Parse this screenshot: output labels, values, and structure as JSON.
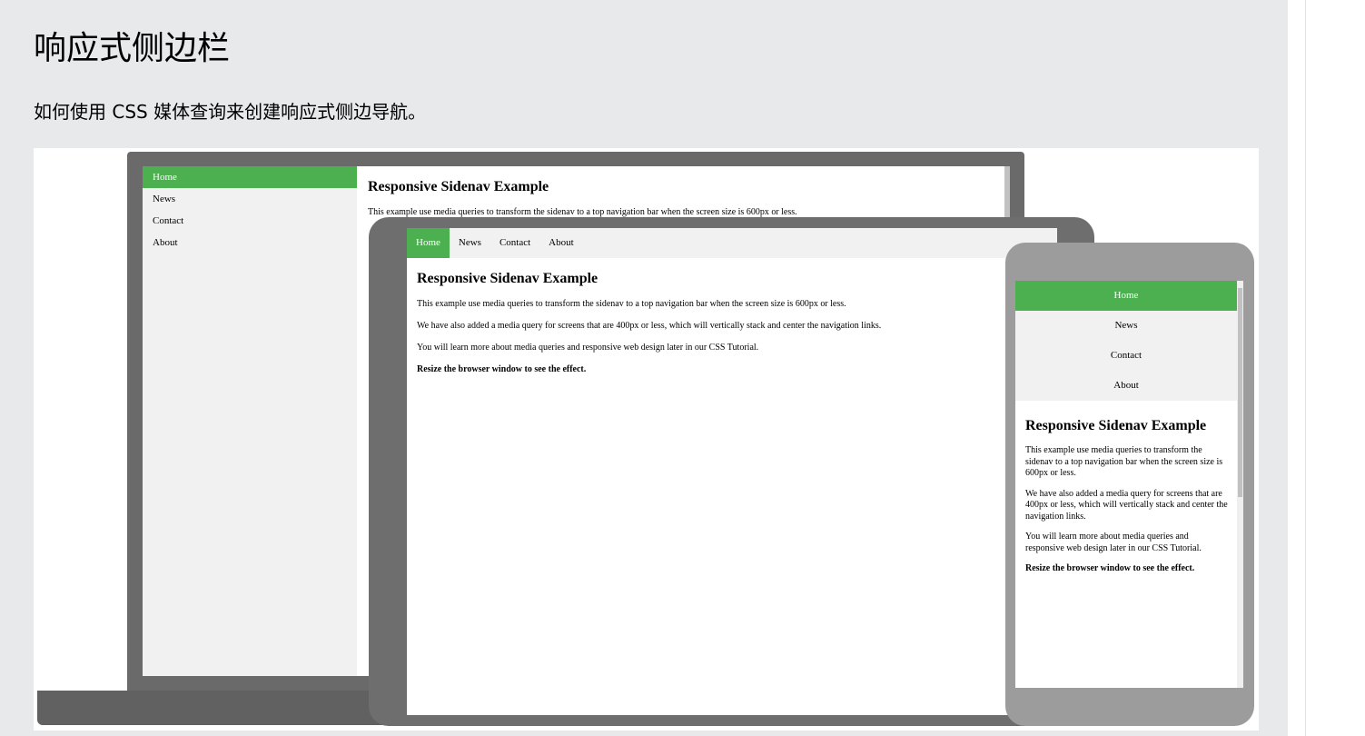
{
  "page": {
    "title": "响应式侧边栏",
    "description": "如何使用 CSS 媒体查询来创建响应式侧边导航。"
  },
  "demo": {
    "nav_items": [
      "Home",
      "News",
      "Contact",
      "About"
    ],
    "heading": "Responsive Sidenav Example",
    "paragraph_1": "This example use media queries to transform the sidenav to a top navigation bar when the screen size is 600px or less.",
    "paragraph_2": "We have also added a media query for screens that are 400px or less, which will vertically stack and center the navigation links.",
    "paragraph_3": "You will learn more about media queries and responsive web design later in our CSS Tutorial.",
    "paragraph_4": "Resize the browser window to see the effect."
  },
  "colors": {
    "panel_bg": "#e7e9eb",
    "active_nav": "#4caf50",
    "nav_bg": "#f1f1f1",
    "laptop_frame": "#6a6a6a",
    "tablet_frame": "#6e6e6e",
    "phone_frame": "#9c9c9c"
  }
}
